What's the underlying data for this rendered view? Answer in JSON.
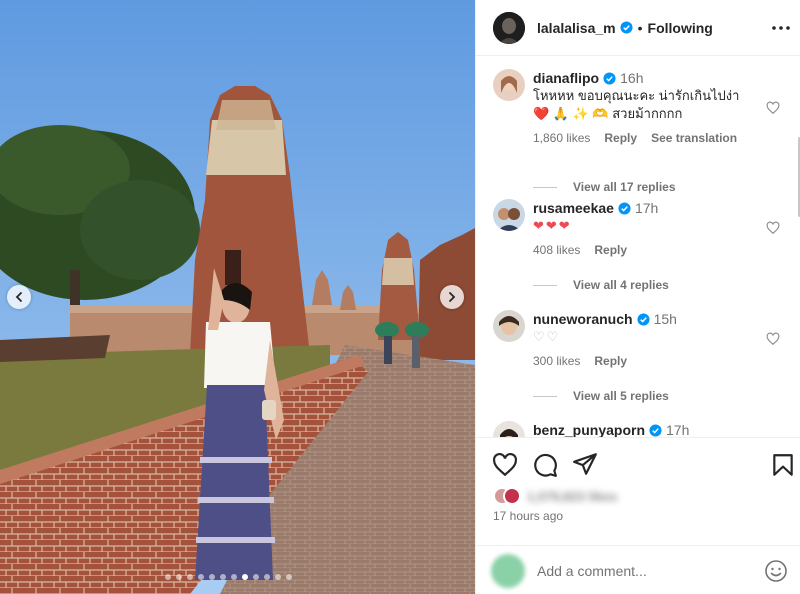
{
  "post": {
    "username": "lalalalisa_m",
    "separator": "•",
    "follow_label": "Following",
    "time_ago": "17 hours ago",
    "likes_blurred": "1,079,823 likes",
    "add_comment_placeholder": "Add a comment...",
    "carousel": {
      "count": 12,
      "active_index": 7
    }
  },
  "icons": {
    "more": "more-horizontal-icon",
    "verified": "verified-badge-icon",
    "like": "heart-icon",
    "comment": "comment-bubble-icon",
    "share": "paper-plane-icon",
    "save": "bookmark-icon",
    "emoji": "emoji-smile-icon",
    "prev": "chevron-left-icon",
    "next": "chevron-right-icon"
  },
  "colors": {
    "verified": "#0095f6",
    "heart": "#ed4956",
    "muted": "#737373",
    "text": "#262626"
  },
  "comments": [
    {
      "username": "dianaflipo",
      "verified": true,
      "time": "16h",
      "text_line1": "โหหหห ขอบคุณนะคะ น่ารักเกินไปง่า",
      "emoji_line": "❤️ 🙏 ✨ 🫶",
      "text_line2": "สวยม้ากกกก",
      "likes": "1,860 likes",
      "reply_label": "Reply",
      "translate_label": "See translation",
      "view_replies": "View all 17 replies"
    },
    {
      "username": "rusameekae",
      "verified": true,
      "time": "17h",
      "text": "❤❤❤",
      "likes": "408 likes",
      "reply_label": "Reply",
      "view_replies": "View all 4 replies"
    },
    {
      "username": "nuneworanuch",
      "verified": true,
      "time": "15h",
      "text": "♡♡",
      "likes": "300 likes",
      "reply_label": "Reply",
      "view_replies": "View all 5 replies"
    },
    {
      "username": "benz_punyaporn",
      "verified": true,
      "time": "17h"
    }
  ]
}
